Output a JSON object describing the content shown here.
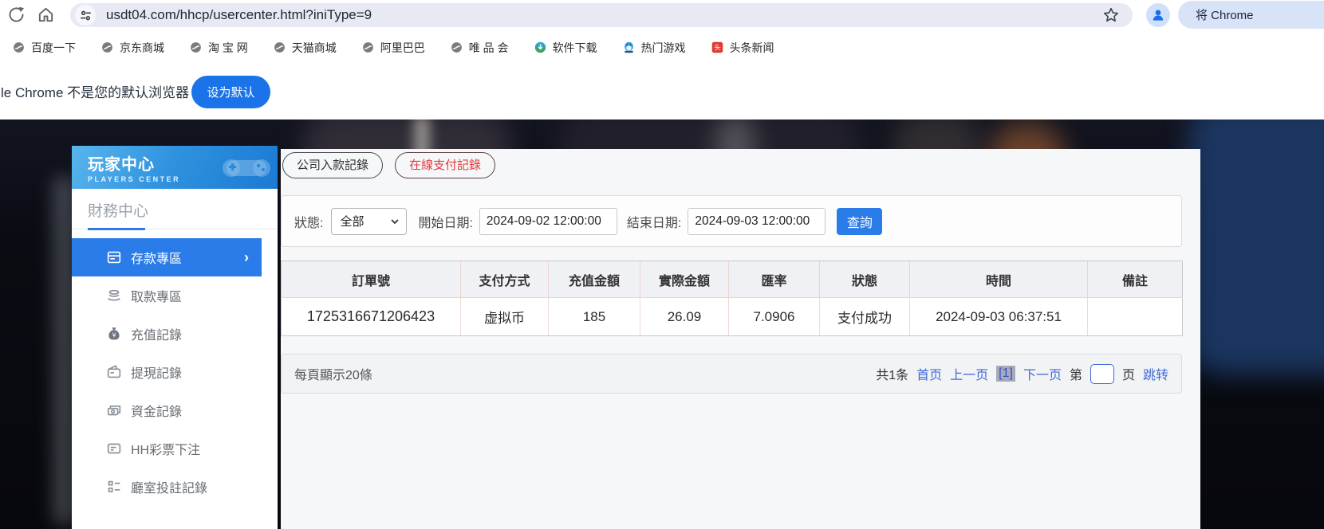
{
  "browser": {
    "url": "usdt04.com/hhcp/usercenter.html?iniType=9",
    "chrome_pill_label": "将 Chrome",
    "bookmarks": [
      {
        "label": "百度一下",
        "icon": "globe-icon"
      },
      {
        "label": "京东商城",
        "icon": "globe-icon"
      },
      {
        "label": "淘 宝 网",
        "icon": "globe-icon"
      },
      {
        "label": "天猫商城",
        "icon": "globe-icon"
      },
      {
        "label": "阿里巴巴",
        "icon": "globe-icon"
      },
      {
        "label": "唯 品 会",
        "icon": "globe-icon"
      },
      {
        "label": "软件下载",
        "icon": "download-icon"
      },
      {
        "label": "热门游戏",
        "icon": "game-icon"
      },
      {
        "label": "头条新闻",
        "icon": "toutiao-icon",
        "icon_glyph": "头"
      }
    ],
    "notification": {
      "text": "le Chrome 不是您的默认浏览器",
      "button": "设为默认"
    }
  },
  "sidebar": {
    "title": "玩家中心",
    "subtitle": "PLAYERS CENTER",
    "section": "財務中心",
    "items": [
      {
        "label": "存款專區",
        "active": true
      },
      {
        "label": "取款專區",
        "active": false
      },
      {
        "label": "充值記錄",
        "active": false
      },
      {
        "label": "提現記錄",
        "active": false
      },
      {
        "label": "資金記錄",
        "active": false
      },
      {
        "label": "HH彩票下注",
        "active": false
      },
      {
        "label": "廳室投註記錄",
        "active": false
      }
    ],
    "active_chevron": "›"
  },
  "main": {
    "tabs": [
      {
        "label": "公司入款記錄",
        "active": false
      },
      {
        "label": "在線支付記錄",
        "active": true
      }
    ],
    "filters": {
      "status_label": "狀態:",
      "status_value": "全部",
      "start_label": "開始日期:",
      "start_value": "2024-09-02 12:00:00",
      "end_label": "結束日期:",
      "end_value": "2024-09-03 12:00:00",
      "search_button": "查詢"
    },
    "table": {
      "headers": [
        "訂單號",
        "支付方式",
        "充值金額",
        "實際金額",
        "匯率",
        "狀態",
        "時間",
        "備註"
      ],
      "rows": [
        [
          "1725316671206423",
          "虚拟币",
          "185",
          "26.09",
          "7.0906",
          "支付成功",
          "2024-09-03 06:37:51",
          ""
        ]
      ]
    },
    "pagination": {
      "page_size_text": "每頁顯示20條",
      "total_text": "共1条",
      "first": "首页",
      "prev": "上一页",
      "current": "[1]",
      "next": "下一页",
      "jump_prefix": "第",
      "jump_suffix": "页",
      "jump_button": "跳转",
      "jump_value": ""
    }
  },
  "colors": {
    "accent_blue": "#2a7ce9",
    "link_blue": "#3e6bd6",
    "tab_active_red": "#e23b3b",
    "chrome_button_blue": "#1a73e8",
    "toutiao_red": "#e0392e"
  }
}
